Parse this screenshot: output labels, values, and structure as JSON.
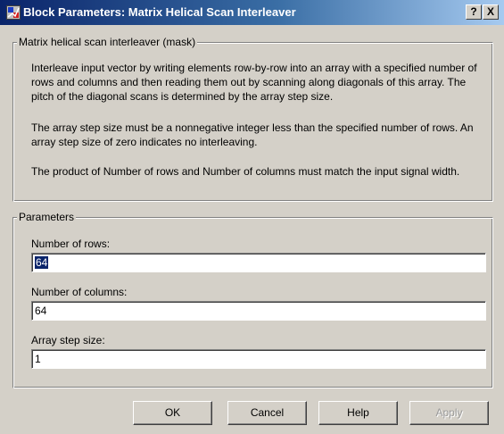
{
  "window": {
    "title": "Block Parameters: Matrix Helical Scan Interleaver",
    "help_glyph": "?",
    "close_glyph": "X"
  },
  "description": {
    "legend": "Matrix helical scan interleaver (mask)",
    "paragraph_1": "Interleave input vector by writing elements row-by-row into an array with a specified number of rows and columns and then reading them out by scanning along diagonals of this array.  The pitch of the diagonal scans is determined by the array step size.",
    "paragraph_2": "The array step size must be a nonnegative integer less than the specified number of rows.  An array step size of zero indicates no interleaving.",
    "paragraph_3": "The product of Number of rows and Number of columns must match the input signal width."
  },
  "parameters": {
    "legend": "Parameters",
    "rows_label": "Number of rows:",
    "rows_value": "64",
    "cols_label": "Number of columns:",
    "cols_value": "64",
    "step_label": "Array step size:",
    "step_value": "1"
  },
  "buttons": {
    "ok": "OK",
    "cancel": "Cancel",
    "help": "Help",
    "apply": "Apply"
  },
  "colors": {
    "titlebar_start": "#0a246a",
    "titlebar_end": "#a6caf0",
    "dialog_face": "#d4d0c8",
    "selection": "#0a246a"
  },
  "icons": {
    "title_icon": "simulink-block-icon"
  }
}
